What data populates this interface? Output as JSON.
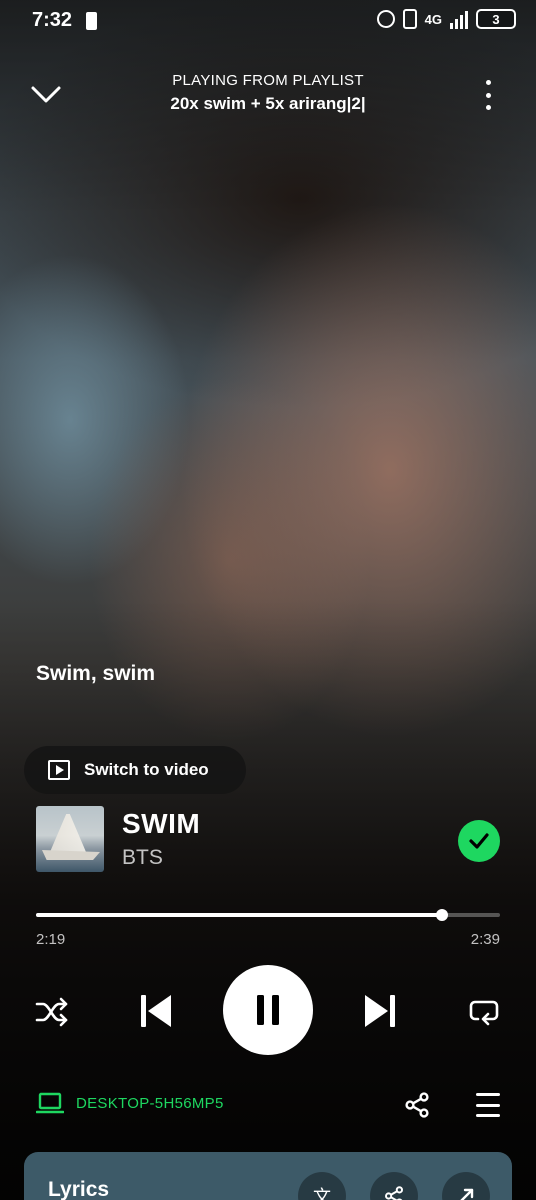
{
  "status_bar": {
    "time": "7:32",
    "network": "4G",
    "battery": "3"
  },
  "header": {
    "context_label": "PLAYING FROM PLAYLIST",
    "playlist_name": "20x swim + 5x arirang|2|"
  },
  "lyric_line": "Swim, swim",
  "switch_video_label": "Switch to video",
  "track": {
    "title": "SWIM",
    "artist": "BTS",
    "added_to_library": true
  },
  "progress": {
    "elapsed": "2:19",
    "total": "2:39",
    "fraction": 0.874
  },
  "controls": {
    "shuffle": "shuffle-icon",
    "previous": "skip-previous-icon",
    "play_state": "pause-icon",
    "next": "skip-next-icon",
    "repeat": "repeat-icon"
  },
  "device": {
    "name": "DESKTOP-5H56MP5"
  },
  "lyrics_card": {
    "title": "Lyrics"
  },
  "colors": {
    "accent": "#1ed760",
    "lyrics_card_bg": "#3d5a68"
  }
}
